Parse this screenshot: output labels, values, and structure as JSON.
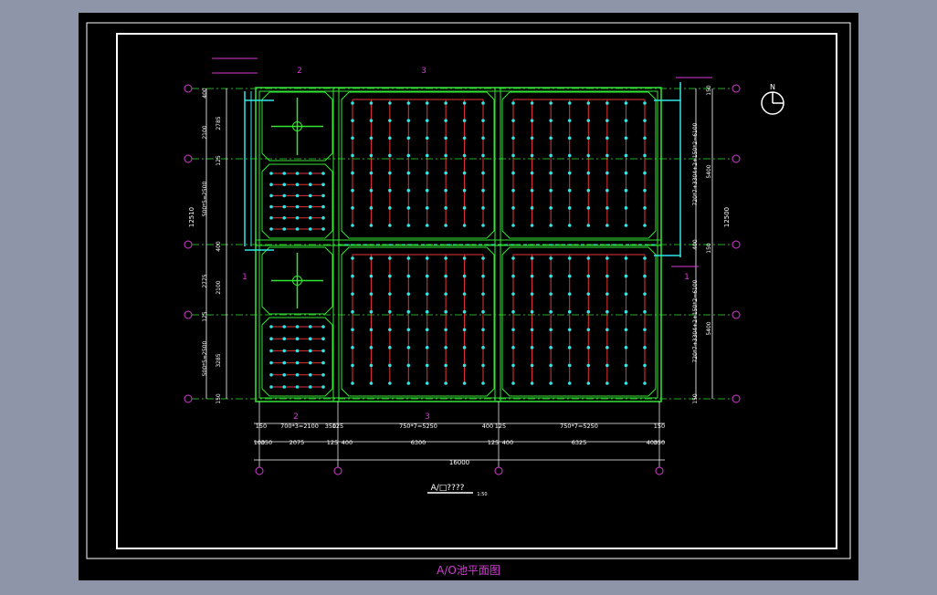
{
  "caption": "A/O池平面图",
  "plan_title": "A/□????",
  "plan_scale": "1:50",
  "north_label": "N",
  "axis_rows": [
    "A",
    "B",
    "C",
    "D",
    "E"
  ],
  "axis_cols": [
    "1",
    "2",
    "3",
    "4"
  ],
  "dim_bottom_row1": [
    "150",
    "700*3=2100",
    "350",
    "125",
    "750*7=5250",
    "400",
    "125",
    "750*7=5250",
    "150"
  ],
  "dim_bottom_row2": [
    "100",
    "350",
    "2075",
    "125",
    "400",
    "6300",
    "125",
    "400",
    "6325",
    "400",
    "350"
  ],
  "dim_total_width": "16000",
  "dim_left_total": "12510",
  "dim_left_segments": [
    "400",
    "2785",
    "2100",
    "125",
    "500*5=2500",
    "400",
    "2775",
    "2100",
    "125",
    "3285",
    "500*5=2500",
    "150"
  ],
  "dim_right_total": "12500",
  "dim_right_segments": [
    "150",
    "720*7+3304+2+150*2=6100",
    "5400",
    "400",
    "150",
    "720*7+3304+2+150*2=6100",
    "5400",
    "150"
  ],
  "section_marks": [
    "1",
    "2",
    "3",
    "1",
    "2",
    "3"
  ],
  "colors": {
    "background": "#000000",
    "frame": "#ffffff",
    "wall": "#33e633",
    "pipe": "#33e6e6",
    "aerator": "#33e6e6",
    "grid_line": "#e63333",
    "annotation": "#d63ad6",
    "text": "#ffffff"
  }
}
